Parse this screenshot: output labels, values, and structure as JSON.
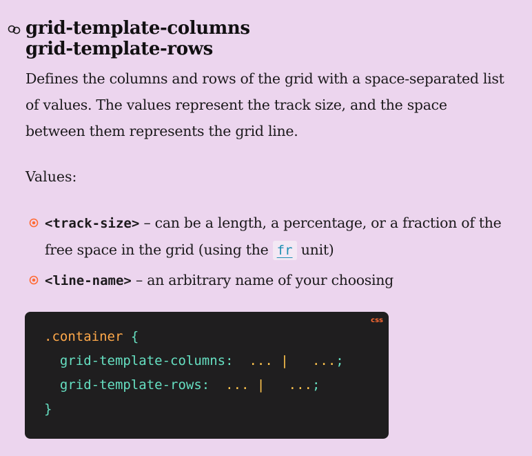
{
  "heading": {
    "line1": "grid-template-columns",
    "line2": "grid-template-rows",
    "anchor_icon": "link-icon"
  },
  "description": "Defines the columns and rows of the grid with a space-separated list of values. The values represent the track size, and the space between them represents the grid line.",
  "values_label": "Values:",
  "values": [
    {
      "term": "<track-size>",
      "text_before_code": " – can be a length, a percentage, or a fraction of the free space in the grid (using the ",
      "code": "fr",
      "text_after_code": " unit)"
    },
    {
      "term": "<line-name>",
      "text": " – an arbitrary name of your choosing"
    }
  ],
  "code_block": {
    "language": "css",
    "selector": ".container",
    "open_brace": "{",
    "lines": [
      {
        "property": "grid-template-columns",
        "colon": ":",
        "values": "... |   ...",
        "semicolon": ";"
      },
      {
        "property": "grid-template-rows",
        "colon": ":",
        "values": "... |   ...",
        "semicolon": ";"
      }
    ],
    "close_brace": "}"
  },
  "colors": {
    "background": "#ecd5ee",
    "bullet": "#ff6a33",
    "code_background": "#1f1e1f",
    "code_property": "#66e0c2",
    "code_value": "#ffc44d",
    "code_selector": "#ffa94a",
    "link": "#1d8fb3"
  }
}
